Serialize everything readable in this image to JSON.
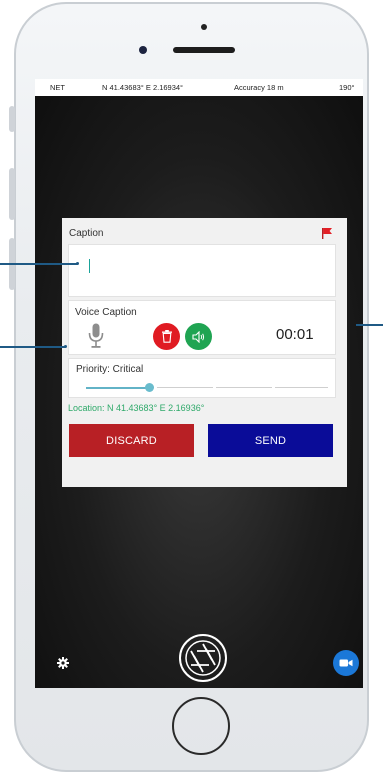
{
  "status_bar": {
    "network": "NET",
    "coordinates": "N 41.43683° E 2.16934°",
    "accuracy": "Accuracy 18 m",
    "heading": "190°"
  },
  "caption": {
    "label": "Caption",
    "value": "",
    "flag_icon": "red-flag-icon"
  },
  "voice_caption": {
    "label": "Voice Caption",
    "timer": "00:01",
    "mic_icon": "microphone-icon",
    "delete_icon": "trash-icon",
    "play_icon": "speaker-icon"
  },
  "priority": {
    "label": "Priority: Critical",
    "level_fraction": 0.25
  },
  "location": {
    "text": "Location: N 41.43683° E 2.16936°"
  },
  "actions": {
    "discard_label": "DISCARD",
    "send_label": "SEND"
  },
  "colors": {
    "discard": "#b82025",
    "send": "#0a0c98",
    "delete": "#e01b22",
    "play": "#1fa452",
    "location_text": "#2fa96a",
    "video": "#1b78d8"
  },
  "controls": {
    "settings_icon": "gear-icon",
    "shutter_icon": "camera-shutter-icon",
    "video_icon": "video-camera-icon"
  }
}
